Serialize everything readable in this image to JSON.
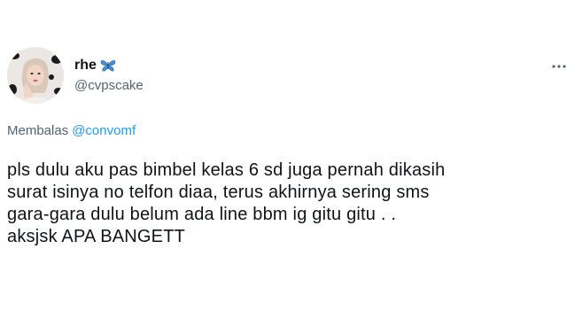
{
  "tweet": {
    "author": {
      "display_name": "rhe",
      "handle": "@cvpscake",
      "name_emoji_icon": "blue-butterfly-icon",
      "avatar_icon": "profile-photo-avatar"
    },
    "reply_to": {
      "label": "Membalas",
      "mention": "@convomf"
    },
    "text_lines": [
      "pls dulu aku pas bimbel kelas 6 sd juga pernah dikasih",
      "surat isinya no telfon diaa, terus akhirnya sering sms",
      "gara-gara dulu belum ada line bbm ig gitu gitu . .",
      "aksjsk APA BANGETT"
    ],
    "more_menu_icon": "more-dots-icon"
  },
  "colors": {
    "primary_text": "#0f1419",
    "secondary_text": "#536471",
    "accent": "#1d9bf0",
    "background": "#ffffff"
  }
}
